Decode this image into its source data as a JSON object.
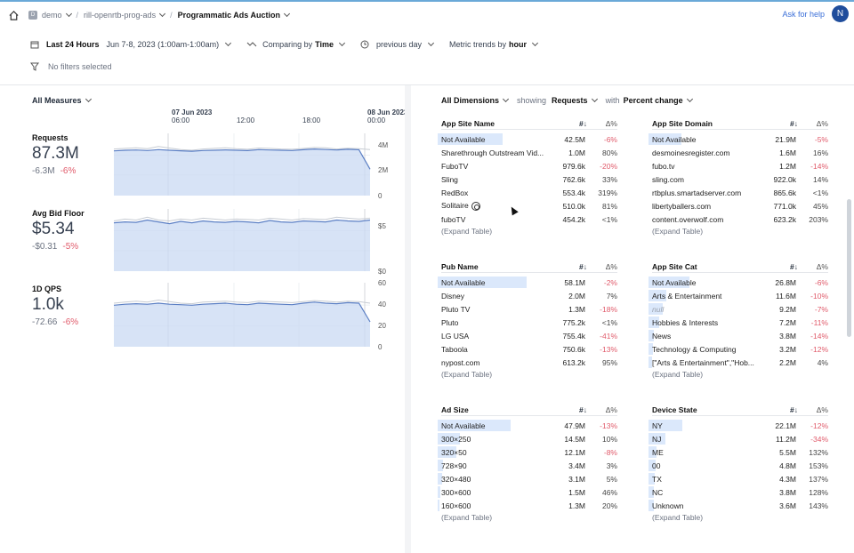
{
  "breadcrumbs": {
    "org": "demo",
    "org_badge": "D",
    "project": "rill-openrtb-prog-ads",
    "dashboard": "Programmatic Ads Auction"
  },
  "header": {
    "help": "Ask for help",
    "avatar": "N"
  },
  "controls": {
    "range_label": "Last 24 Hours",
    "range_dates": "Jun 7-8, 2023 (1:00am-1:00am)",
    "comparing_prefix": "Comparing by",
    "comparing_value": "Time",
    "previous": "previous day",
    "trends_prefix": "Metric trends by",
    "trends_value": "hour"
  },
  "filters": {
    "text": "No filters selected"
  },
  "left": {
    "all_measures": "All Measures",
    "time_ticks": [
      {
        "date": "07 Jun 2023",
        "time": "06:00"
      },
      {
        "date": "",
        "time": "12:00"
      },
      {
        "date": "",
        "time": "18:00"
      },
      {
        "date": "08 Jun 2023",
        "time": "00:00"
      }
    ],
    "measures": [
      {
        "name": "Requests",
        "value": "87.3M",
        "delta_abs": "-6.3M",
        "delta_pct": "-6%",
        "axis": [
          "4M",
          "2M",
          "0"
        ]
      },
      {
        "name": "Avg Bid Floor",
        "value": "$5.34",
        "delta_abs": "-$0.31",
        "delta_pct": "-5%",
        "axis": [
          "$5",
          "$0"
        ]
      },
      {
        "name": "1D QPS",
        "value": "1.0k",
        "delta_abs": "-72.66",
        "delta_pct": "-6%",
        "axis": [
          "60",
          "40",
          "20",
          "0"
        ]
      }
    ]
  },
  "chart_data": [
    {
      "type": "area",
      "title": "Requests",
      "ylim": [
        0,
        4800000
      ],
      "values": [
        3550000,
        3600000,
        3620000,
        3580000,
        3650000,
        3600000,
        3560000,
        3520000,
        3580000,
        3600000,
        3630000,
        3600000,
        3570000,
        3650000,
        3620000,
        3600000,
        3580000,
        3640000,
        3700000,
        3660000,
        3620000,
        3680000,
        3640000,
        2100000
      ],
      "comparison": [
        3700000,
        3750000,
        3800000,
        3720000,
        3900000,
        3780000,
        3650000,
        3600000,
        3700000,
        3750000,
        3800000,
        3720000,
        3680000,
        3780000,
        3750000,
        3700000,
        3680000,
        3740000,
        3820000,
        3790000,
        3700000,
        3760000,
        3720000,
        3650000
      ]
    },
    {
      "type": "area",
      "title": "Avg Bid Floor",
      "ylim": [
        0,
        6.5
      ],
      "values": [
        5.2,
        5.3,
        5.25,
        5.5,
        5.3,
        5.1,
        5.35,
        5.2,
        5.4,
        5.3,
        5.25,
        5.35,
        5.3,
        5.2,
        5.45,
        5.3,
        5.25,
        5.4,
        5.35,
        5.3,
        5.5,
        5.4,
        5.35,
        5.5
      ],
      "comparison": [
        5.4,
        5.6,
        5.5,
        5.8,
        5.5,
        5.4,
        5.6,
        5.5,
        5.7,
        5.6,
        5.5,
        5.6,
        5.55,
        5.5,
        5.7,
        5.6,
        5.5,
        5.65,
        5.6,
        5.55,
        5.8,
        5.7,
        5.6,
        5.7
      ]
    },
    {
      "type": "area",
      "title": "1D QPS",
      "ylim": [
        0,
        60
      ],
      "values": [
        40,
        41,
        41.5,
        41,
        42,
        41,
        40.5,
        40,
        41,
        41.5,
        42,
        41,
        40.5,
        42,
        41.5,
        41,
        40.5,
        42,
        43,
        42,
        41.5,
        42.5,
        42,
        24
      ],
      "comparison": [
        42,
        43,
        44,
        43,
        45,
        43.5,
        42,
        41.5,
        43,
        43.5,
        44,
        43,
        42.5,
        44,
        43.5,
        43,
        42.5,
        43.5,
        44.5,
        44,
        43,
        44,
        43.5,
        42
      ]
    }
  ],
  "right": {
    "all_dimensions": "All Dimensions",
    "showing": "showing",
    "measure": "Requests",
    "with": "with",
    "compare": "Percent change",
    "col_value": "#↓",
    "col_delta": "Δ%",
    "expand": "(Expand Table)",
    "tables": [
      {
        "title": "App Site Name",
        "rows": [
          {
            "name": "Not Available",
            "value": "42.5M",
            "delta": "-6%",
            "bar": 0.73
          },
          {
            "name": "Sharethrough Outstream Vid...",
            "value": "1.0M",
            "delta": "80%",
            "bar": 0
          },
          {
            "name": "FuboTV",
            "value": "979.6k",
            "delta": "-20%",
            "bar": 0
          },
          {
            "name": "Sling",
            "value": "762.6k",
            "delta": "33%",
            "bar": 0
          },
          {
            "name": "RedBox",
            "value": "553.4k",
            "delta": "319%",
            "bar": 0
          },
          {
            "name": "Solitaire",
            "value": "510.0k",
            "delta": "81%",
            "bar": 0,
            "icon": true
          },
          {
            "name": "fuboTV",
            "value": "454.2k",
            "delta": "<1%",
            "bar": 0
          }
        ]
      },
      {
        "title": "App Site Domain",
        "rows": [
          {
            "name": "Not Available",
            "value": "21.9M",
            "delta": "-5%",
            "bar": 0.37
          },
          {
            "name": "desmoinesregister.com",
            "value": "1.6M",
            "delta": "16%",
            "bar": 0
          },
          {
            "name": "fubo.tv",
            "value": "1.2M",
            "delta": "-14%",
            "bar": 0
          },
          {
            "name": "sling.com",
            "value": "922.0k",
            "delta": "14%",
            "bar": 0
          },
          {
            "name": "rtbplus.smartadserver.com",
            "value": "865.6k",
            "delta": "<1%",
            "bar": 0
          },
          {
            "name": "libertyballers.com",
            "value": "771.0k",
            "delta": "45%",
            "bar": 0
          },
          {
            "name": "content.overwolf.com",
            "value": "623.2k",
            "delta": "203%",
            "bar": 0
          }
        ]
      },
      {
        "title": "Pub Name",
        "rows": [
          {
            "name": "Not Available",
            "value": "58.1M",
            "delta": "-2%",
            "bar": 1.0
          },
          {
            "name": "Disney",
            "value": "2.0M",
            "delta": "7%",
            "bar": 0
          },
          {
            "name": "Pluto TV",
            "value": "1.3M",
            "delta": "-18%",
            "bar": 0
          },
          {
            "name": "Pluto",
            "value": "775.2k",
            "delta": "<1%",
            "bar": 0
          },
          {
            "name": "LG USA",
            "value": "755.4k",
            "delta": "-41%",
            "bar": 0
          },
          {
            "name": "Taboola",
            "value": "750.6k",
            "delta": "-13%",
            "bar": 0
          },
          {
            "name": "nypost.com",
            "value": "613.2k",
            "delta": "95%",
            "bar": 0
          }
        ]
      },
      {
        "title": "App Site Cat",
        "rows": [
          {
            "name": "Not Available",
            "value": "26.8M",
            "delta": "-6%",
            "bar": 0.46
          },
          {
            "name": "Arts & Entertainment",
            "value": "11.6M",
            "delta": "-10%",
            "bar": 0.2
          },
          {
            "name": "null",
            "value": "9.2M",
            "delta": "-7%",
            "bar": 0.16,
            "italic": true
          },
          {
            "name": "Hobbies & Interests",
            "value": "7.2M",
            "delta": "-11%",
            "bar": 0.12
          },
          {
            "name": "News",
            "value": "3.8M",
            "delta": "-14%",
            "bar": 0.06
          },
          {
            "name": "Technology & Computing",
            "value": "3.2M",
            "delta": "-12%",
            "bar": 0.05
          },
          {
            "name": "[\"Arts & Entertainment\",\"Hob...",
            "value": "2.2M",
            "delta": "4%",
            "bar": 0.04
          }
        ]
      },
      {
        "title": "Ad Size",
        "rows": [
          {
            "name": "Not Available",
            "value": "47.9M",
            "delta": "-13%",
            "bar": 0.82
          },
          {
            "name": "300×250",
            "value": "14.5M",
            "delta": "10%",
            "bar": 0.25
          },
          {
            "name": "320×50",
            "value": "12.1M",
            "delta": "-8%",
            "bar": 0.21
          },
          {
            "name": "728×90",
            "value": "3.4M",
            "delta": "3%",
            "bar": 0.06
          },
          {
            "name": "320×480",
            "value": "3.1M",
            "delta": "5%",
            "bar": 0.05
          },
          {
            "name": "300×600",
            "value": "1.5M",
            "delta": "46%",
            "bar": 0.03
          },
          {
            "name": "160×600",
            "value": "1.3M",
            "delta": "20%",
            "bar": 0.02
          }
        ]
      },
      {
        "title": "Device State",
        "rows": [
          {
            "name": "NY",
            "value": "22.1M",
            "delta": "-12%",
            "bar": 0.38
          },
          {
            "name": "NJ",
            "value": "11.2M",
            "delta": "-34%",
            "bar": 0.19
          },
          {
            "name": "ME",
            "value": "5.5M",
            "delta": "132%",
            "bar": 0.09
          },
          {
            "name": "00",
            "value": "4.8M",
            "delta": "153%",
            "bar": 0.08
          },
          {
            "name": "TX",
            "value": "4.3M",
            "delta": "137%",
            "bar": 0.07
          },
          {
            "name": "NC",
            "value": "3.8M",
            "delta": "128%",
            "bar": 0.06
          },
          {
            "name": "Unknown",
            "value": "3.6M",
            "delta": "143%",
            "bar": 0.06
          }
        ]
      }
    ]
  },
  "colors": {
    "accent": "#3b6fd8",
    "negative": "#e05a6a",
    "bar": "#dbe8fb",
    "line": "#5b7fc4",
    "area": "#c9d9f3"
  }
}
